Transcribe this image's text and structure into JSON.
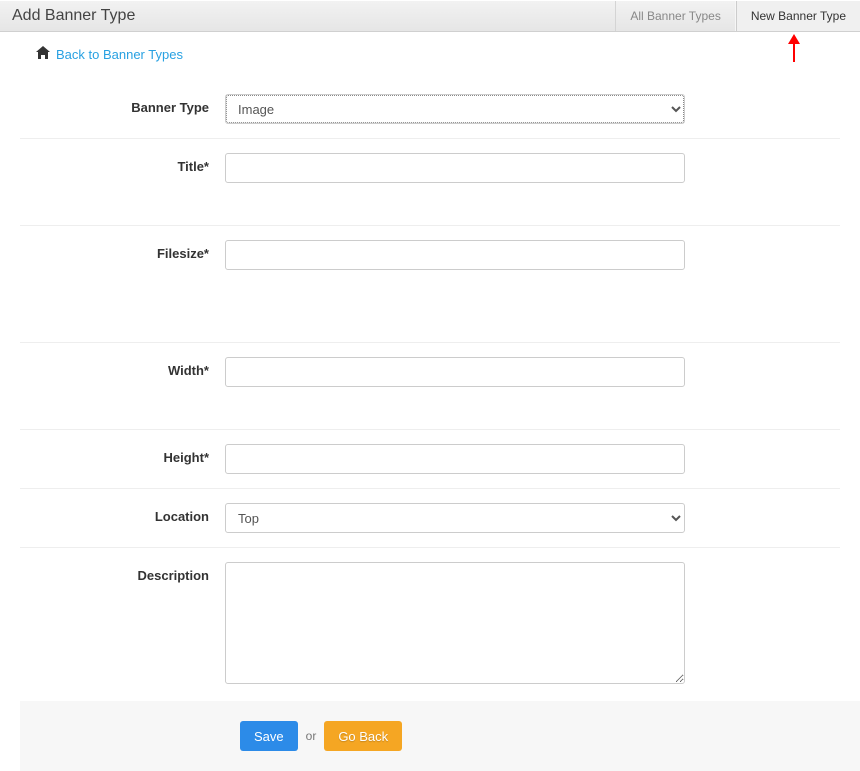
{
  "header": {
    "title": "Add Banner Type",
    "tabs": {
      "all": "All Banner Types",
      "new": "New Banner Type"
    }
  },
  "nav": {
    "back_label": "Back to Banner Types"
  },
  "form": {
    "banner_type": {
      "label": "Banner Type",
      "value": "Image"
    },
    "title": {
      "label": "Title*",
      "value": ""
    },
    "filesize": {
      "label": "Filesize*",
      "value": ""
    },
    "width": {
      "label": "Width*",
      "value": ""
    },
    "height": {
      "label": "Height*",
      "value": ""
    },
    "location": {
      "label": "Location",
      "value": "Top"
    },
    "description": {
      "label": "Description",
      "value": ""
    }
  },
  "footer": {
    "save": "Save",
    "or": "or",
    "go_back": "Go Back"
  }
}
